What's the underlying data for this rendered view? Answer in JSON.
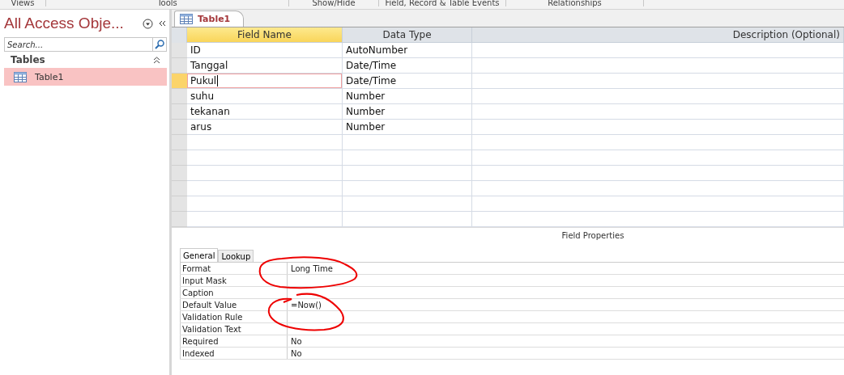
{
  "ribbon_groups": [
    "Views",
    "Tools",
    "Show/Hide",
    "Field, Record & Table Events",
    "Relationships"
  ],
  "navigation": {
    "title": "All Access Obje...",
    "search": {
      "placeholder": "Search..."
    },
    "section": "Tables",
    "items": [
      {
        "label": "Table1",
        "selected": true
      }
    ]
  },
  "document_tab": {
    "label": "Table1"
  },
  "table": {
    "columns": [
      "Field Name",
      "Data Type",
      "Description (Optional)"
    ],
    "rows": [
      {
        "field_name": "ID",
        "data_type": "AutoNumber",
        "selected": false
      },
      {
        "field_name": "Tanggal",
        "data_type": "Date/Time",
        "selected": false
      },
      {
        "field_name": "Pukul",
        "data_type": "Date/Time",
        "selected": true
      },
      {
        "field_name": "suhu",
        "data_type": "Number",
        "selected": false
      },
      {
        "field_name": "tekanan",
        "data_type": "Number",
        "selected": false
      },
      {
        "field_name": "arus",
        "data_type": "Number",
        "selected": false
      }
    ]
  },
  "field_properties": {
    "title": "Field Properties",
    "tabs": [
      {
        "label": "General",
        "selected": true
      },
      {
        "label": "Lookup",
        "selected": false
      }
    ],
    "properties": [
      {
        "name": "Format",
        "value": "Long Time"
      },
      {
        "name": "Input Mask"
      },
      {
        "name": "Caption"
      },
      {
        "name": "Default Value",
        "value": "=Now()"
      },
      {
        "name": "Validation Rule"
      },
      {
        "name": "Validation Text"
      },
      {
        "name": "Required",
        "value": "No"
      },
      {
        "name": "Indexed",
        "value": "No"
      }
    ]
  }
}
